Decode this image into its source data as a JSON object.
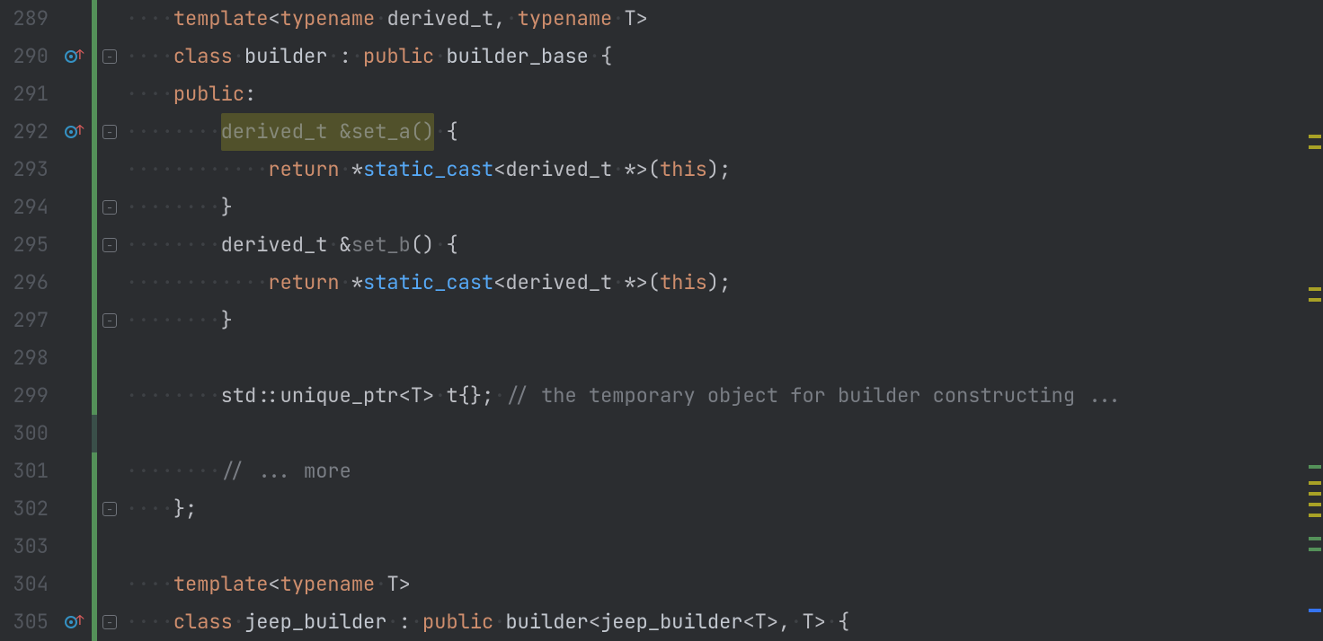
{
  "lines": {
    "start": 289,
    "end": 305,
    "numbers": [
      "289",
      "290",
      "291",
      "292",
      "293",
      "294",
      "295",
      "296",
      "297",
      "298",
      "299",
      "300",
      "301",
      "302",
      "303",
      "304",
      "305"
    ]
  },
  "gutter": {
    "implements_marker": "implements",
    "fold_collapse": "−"
  },
  "code": {
    "l289": {
      "template": "template",
      "typename1": "typename",
      "derived_t": "derived_t",
      "comma": ",",
      "typename2": "typename",
      "T": "T"
    },
    "l290": {
      "class": "class",
      "builder": "builder",
      "colon": ":",
      "public": "public",
      "builder_base": "builder_base",
      "brace": "{"
    },
    "l291": {
      "public": "public",
      "colon": ":"
    },
    "l292": {
      "derived_t": "derived_t",
      "amp": "&",
      "set_a": "set_a",
      "parens": "()",
      "brace": "{"
    },
    "l293": {
      "return": "return",
      "star": "*",
      "static_cast": "static_cast",
      "lt": "<",
      "derived_t": "derived_t",
      "starptr": "*",
      "gt": ">",
      "open": "(",
      "this": "this",
      "close": ")",
      "semi": ";"
    },
    "l294": {
      "brace": "}"
    },
    "l295": {
      "derived_t": "derived_t",
      "amp": "&",
      "set_b": "set_b",
      "parens": "()",
      "brace": "{"
    },
    "l296": {
      "return": "return",
      "star": "*",
      "static_cast": "static_cast",
      "lt": "<",
      "derived_t": "derived_t",
      "starptr": "*",
      "gt": ">",
      "open": "(",
      "this": "this",
      "close": ")",
      "semi": ";"
    },
    "l297": {
      "brace": "}"
    },
    "l299": {
      "std": "std",
      "scope": "::",
      "unique_ptr": "unique_ptr",
      "lt": "<",
      "T": "T",
      "gt": ">",
      "t": "t",
      "braces": "{}",
      "semi": ";",
      "comment": "// the temporary object for builder constructing ..."
    },
    "l301": {
      "comment": "// ... more"
    },
    "l302": {
      "brace": "}",
      "semi": ";"
    },
    "l304": {
      "template": "template",
      "typename": "typename",
      "T": "T"
    },
    "l305": {
      "class": "class",
      "jeep_builder": "jeep_builder",
      "colon": ":",
      "public": "public",
      "builder": "builder",
      "lt": "<",
      "jeep_builder2": "jeep_builder",
      "lt2": "<",
      "T": "T",
      "gt2": ">",
      "comma": ",",
      "T2": "T",
      "gt": ">",
      "brace": "{"
    }
  },
  "overview": {
    "marks": [
      {
        "pos": 150,
        "color": "yellow"
      },
      {
        "pos": 162,
        "color": "yellow"
      },
      {
        "pos": 320,
        "color": "yellow"
      },
      {
        "pos": 332,
        "color": "yellow"
      },
      {
        "pos": 518,
        "color": "green"
      },
      {
        "pos": 536,
        "color": "yellow"
      },
      {
        "pos": 548,
        "color": "yellow"
      },
      {
        "pos": 560,
        "color": "yellow"
      },
      {
        "pos": 572,
        "color": "yellow"
      },
      {
        "pos": 598,
        "color": "green"
      },
      {
        "pos": 610,
        "color": "green"
      },
      {
        "pos": 678,
        "color": "blue"
      }
    ]
  }
}
